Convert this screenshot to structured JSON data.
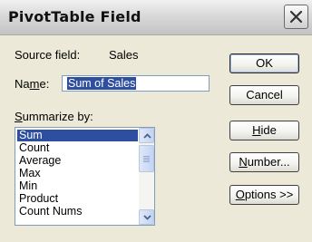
{
  "dialog": {
    "title": "PivotTable Field",
    "source_field_label": "Source field:",
    "source_field_value": "Sales",
    "name_label": "Name:",
    "name_value": "Sum of Sales",
    "summarize_label": "Summarize by:",
    "summarize_options": [
      "Sum",
      "Count",
      "Average",
      "Max",
      "Min",
      "Product",
      "Count Nums"
    ],
    "selected_option": "Sum",
    "buttons": {
      "ok": "OK",
      "cancel": "Cancel",
      "hide": "Hide",
      "number": "Number...",
      "options": "Options >>"
    },
    "icons": {
      "close": "close-icon",
      "scroll_up": "chevron-up-icon",
      "scroll_down": "chevron-down-icon"
    },
    "colors": {
      "selection": "#2e4ea0",
      "face": "#ece9d8"
    }
  }
}
